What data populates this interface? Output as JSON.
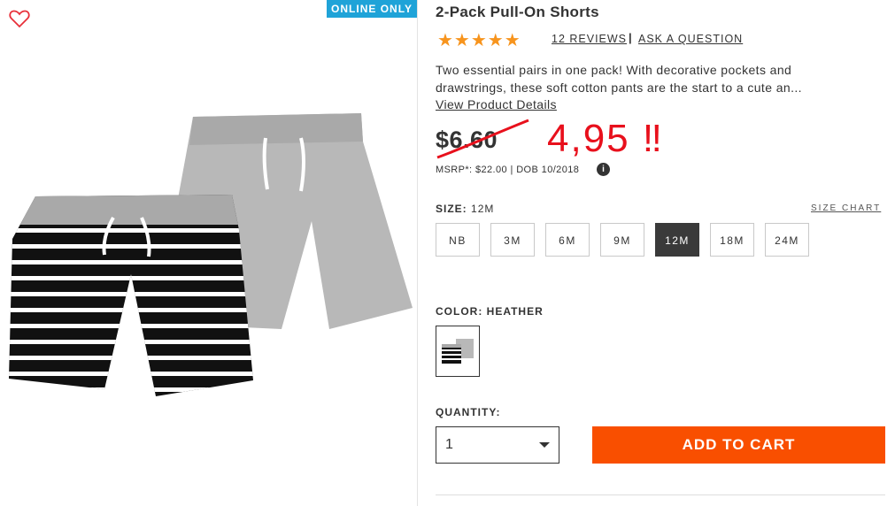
{
  "badge": "ONLINE ONLY",
  "product": {
    "title": "2-Pack Pull-On Shorts",
    "stars": "★★★★★",
    "reviews": "12 REVIEWS",
    "separator": "|",
    "ask": "ASK A QUESTION",
    "description": "Two essential pairs in one pack! With decorative pockets and drawstrings, these soft cotton pants are the start to a cute an...",
    "view_details": "View Product Details"
  },
  "price": {
    "old": "$6.60",
    "handwritten_new": "4,95 ‼",
    "msrp": "MSRP*: $22.00 | DOB 10/2018",
    "info_icon": "i"
  },
  "size": {
    "label": "SIZE:",
    "selected": "12M",
    "chart": "SIZE CHART",
    "options": [
      "NB",
      "3M",
      "6M",
      "9M",
      "12M",
      "18M",
      "24M"
    ]
  },
  "color": {
    "label": "COLOR: HEATHER"
  },
  "quantity": {
    "label": "QUANTITY:",
    "value": "1"
  },
  "cart": {
    "button": "ADD TO CART"
  },
  "colors": {
    "badge": "#1fa3d8",
    "star": "#f7941d",
    "cart": "#f94f00",
    "annotation": "#e8101c"
  }
}
